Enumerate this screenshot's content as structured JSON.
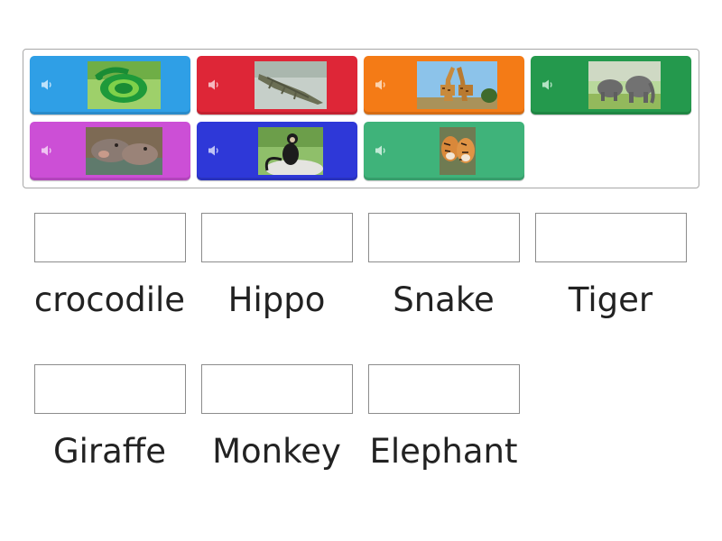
{
  "tiles": [
    {
      "id": "snake",
      "color": "#2f9fe6",
      "icon": "speaker-icon",
      "image": "snake-image"
    },
    {
      "id": "crocodile",
      "color": "#de2637",
      "icon": "speaker-icon",
      "image": "crocodile-image"
    },
    {
      "id": "giraffe",
      "color": "#f47b16",
      "icon": "speaker-icon",
      "image": "giraffe-image"
    },
    {
      "id": "elephant",
      "color": "#24994d",
      "icon": "speaker-icon",
      "image": "elephant-image"
    },
    {
      "id": "hippo",
      "color": "#cc4fd6",
      "icon": "speaker-icon",
      "image": "hippo-image"
    },
    {
      "id": "monkey",
      "color": "#2e38d8",
      "icon": "speaker-icon",
      "image": "monkey-image"
    },
    {
      "id": "tiger",
      "color": "#3fb37a",
      "icon": "speaker-icon",
      "image": "tiger-image"
    }
  ],
  "targets": [
    {
      "label": "crocodile"
    },
    {
      "label": "Hippo"
    },
    {
      "label": "Snake"
    },
    {
      "label": "Tiger"
    },
    {
      "label": "Giraffe"
    },
    {
      "label": "Monkey"
    },
    {
      "label": "Elephant"
    }
  ]
}
